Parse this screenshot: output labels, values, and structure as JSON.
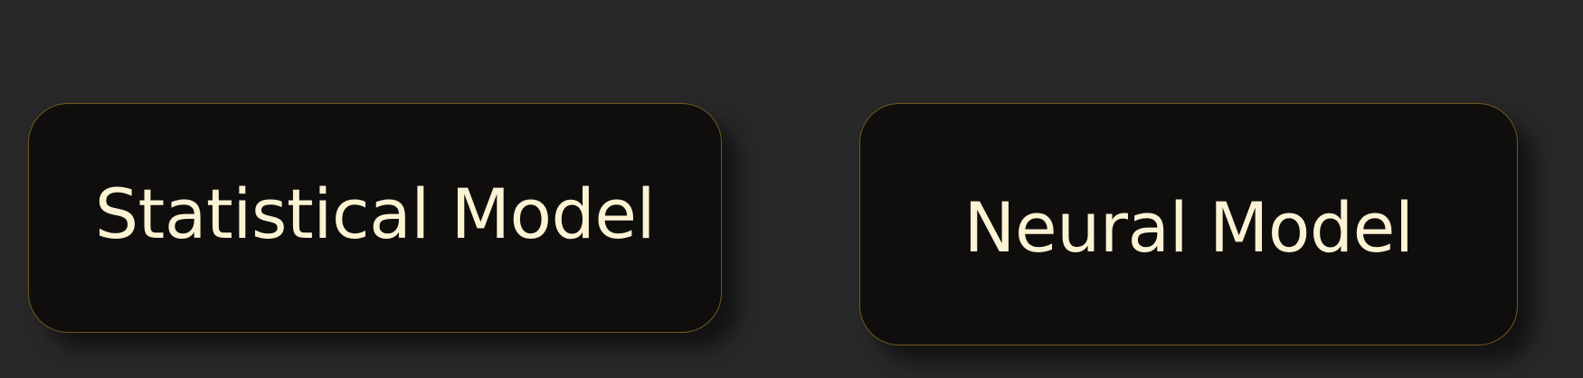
{
  "diagram": {
    "nodes": [
      {
        "id": "statistical",
        "label": "Statistical Model"
      },
      {
        "id": "neural",
        "label": "Neural Model"
      }
    ]
  },
  "colors": {
    "background": "#282828",
    "node_fill": "#0f0e0d",
    "node_border": "#6e5a1c",
    "label_text": "#fbf3d4"
  }
}
